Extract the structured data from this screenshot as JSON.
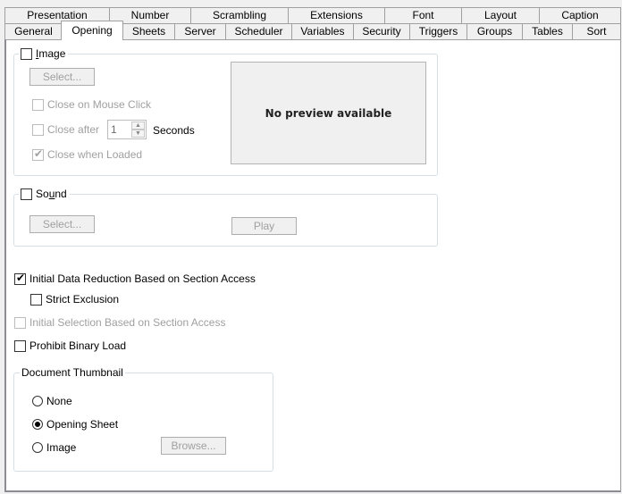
{
  "tabs": {
    "row1": [
      {
        "label": "Presentation"
      },
      {
        "label": "Number"
      },
      {
        "label": "Scrambling"
      },
      {
        "label": "Extensions"
      },
      {
        "label": "Font"
      },
      {
        "label": "Layout"
      },
      {
        "label": "Caption"
      }
    ],
    "row2": [
      {
        "label": "General"
      },
      {
        "label": "Opening",
        "selected": true
      },
      {
        "label": "Sheets"
      },
      {
        "label": "Server"
      },
      {
        "label": "Scheduler"
      },
      {
        "label": "Variables"
      },
      {
        "label": "Security"
      },
      {
        "label": "Triggers"
      },
      {
        "label": "Groups"
      },
      {
        "label": "Tables"
      },
      {
        "label": "Sort"
      }
    ]
  },
  "image_group": {
    "label_prefix": "",
    "label_mnemonic": "I",
    "label_rest": "mage",
    "checked": false,
    "select_button": "Select...",
    "close_on_click": {
      "label": "Close on Mouse Click",
      "checked": false
    },
    "close_after": {
      "label": "Close after",
      "checked": false,
      "value": "1",
      "unit": "Seconds"
    },
    "close_when_loaded": {
      "label": "Close when Loaded",
      "checked": true
    },
    "preview_text": "No preview available"
  },
  "sound_group": {
    "label_prefix": "So",
    "label_mnemonic": "u",
    "label_rest": "nd",
    "checked": false,
    "select_button": "Select...",
    "play_button": "Play"
  },
  "options": {
    "initial_data_reduction": {
      "label": "Initial Data Reduction Based on Section Access",
      "checked": true
    },
    "strict_exclusion": {
      "label": "Strict Exclusion",
      "checked": false
    },
    "initial_selection": {
      "label": "Initial Selection Based on Section Access",
      "checked": false
    },
    "prohibit_binary_load": {
      "label": "Prohibit Binary Load",
      "checked": false
    }
  },
  "thumbnail_group": {
    "title": "Document Thumbnail",
    "options": [
      {
        "label": "None",
        "selected": false
      },
      {
        "label": "Opening Sheet",
        "selected": true
      },
      {
        "label": "Image",
        "selected": false
      }
    ],
    "browse_button": "Browse..."
  }
}
